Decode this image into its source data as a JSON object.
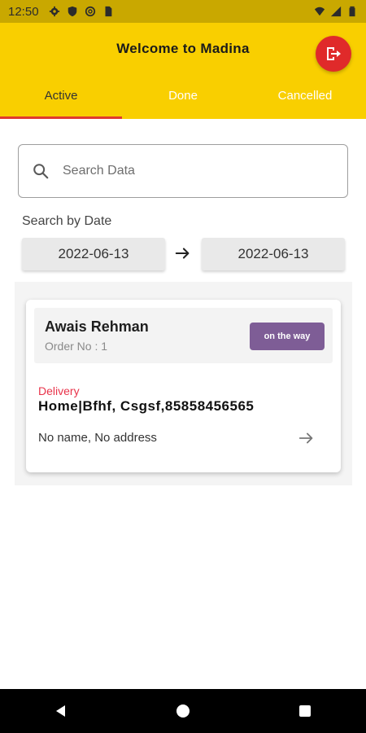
{
  "status_bar": {
    "time": "12:50",
    "icons": [
      "gear-icon",
      "shield-icon",
      "at-icon",
      "sim-icon",
      "wifi-icon",
      "signal-icon",
      "battery-icon"
    ]
  },
  "app_bar": {
    "title": "Welcome to Madina",
    "logout_icon": "logout-icon",
    "colors": {
      "background": "#f9cf00",
      "logout": "#e02a2a",
      "tab_indicator": "#e03a2f"
    }
  },
  "tabs": [
    {
      "label": "Active",
      "active": true
    },
    {
      "label": "Done",
      "active": false
    },
    {
      "label": "Cancelled",
      "active": false
    }
  ],
  "search": {
    "placeholder": "Search Data",
    "value": ""
  },
  "date_filter": {
    "label": "Search by Date",
    "from": "2022-06-13",
    "to": "2022-06-13"
  },
  "orders": [
    {
      "customer": "Awais Rehman",
      "order_no": "Order No : 1",
      "status": "on the way",
      "status_color": "#7e5d96",
      "delivery_label": "Delivery",
      "address": "Home|Bfhf, Csgsf,85858456565",
      "recipient": "No name, No address"
    }
  ],
  "nav_bar": {
    "icons": [
      "back-icon",
      "home-icon",
      "recents-icon"
    ]
  }
}
